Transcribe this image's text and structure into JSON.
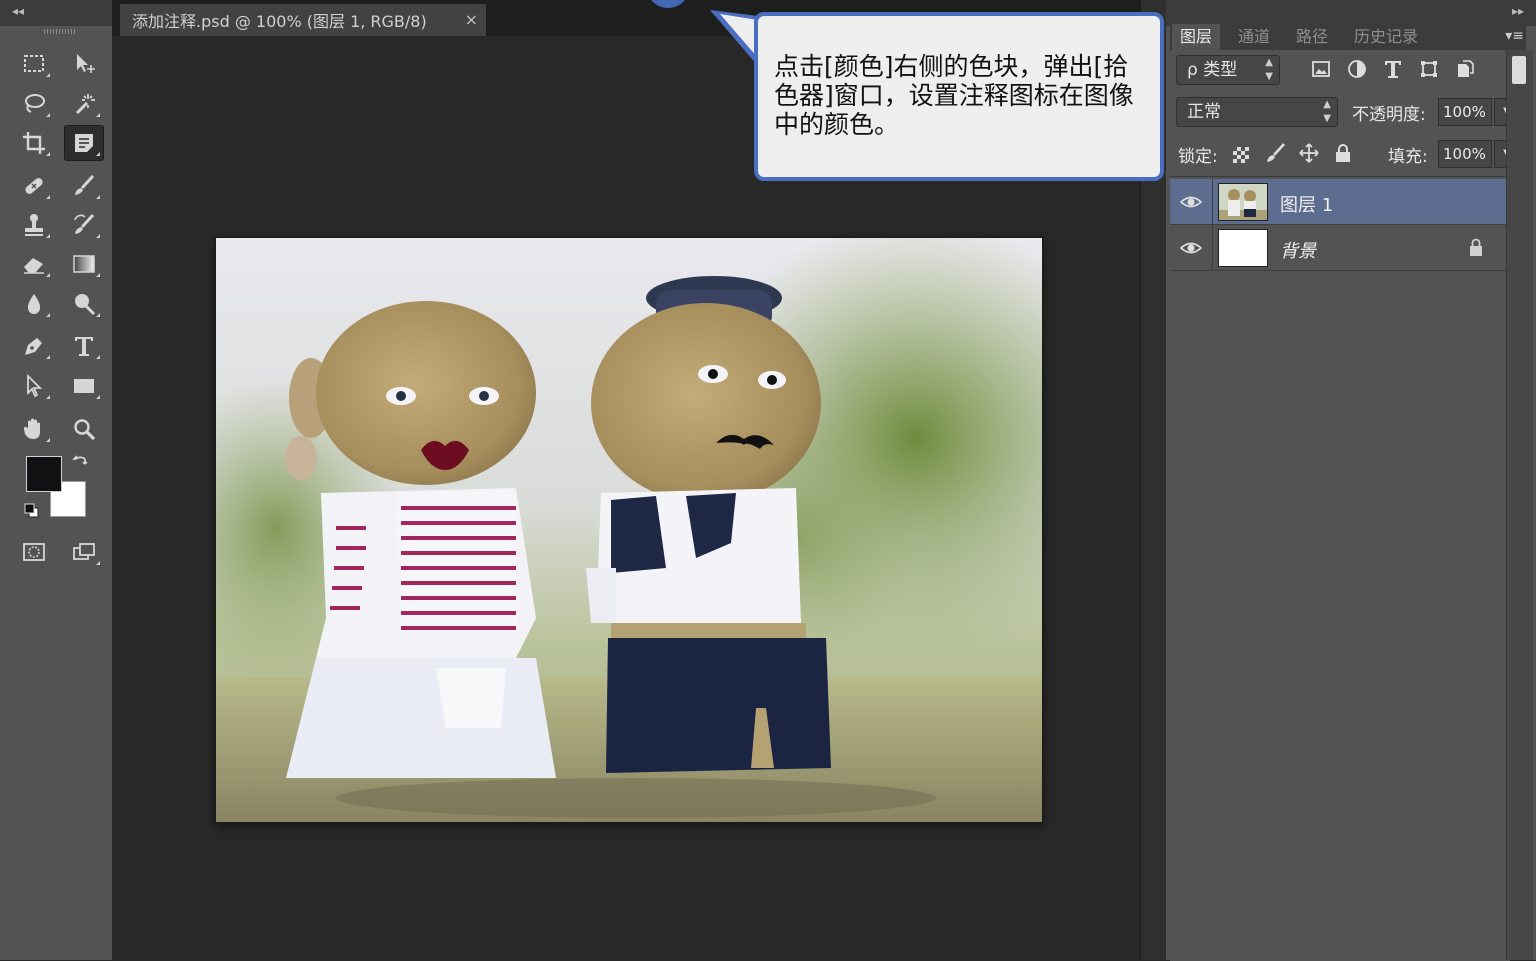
{
  "document": {
    "tab_title": "添加注释.psd @ 100% (图层 1, RGB/8)",
    "close_glyph": "×"
  },
  "callout": {
    "text": "点击[颜色]右侧的色块，弹出[拾色器]窗口，设置注释图标在图像中的颜色。",
    "border_color": "#4a6fc0"
  },
  "toolbar": {
    "collapse_glyph": "◂◂",
    "tools": [
      {
        "name": "rectangular-marquee-icon"
      },
      {
        "name": "move-icon"
      },
      {
        "name": "lasso-icon"
      },
      {
        "name": "magic-wand-icon"
      },
      {
        "name": "crop-icon"
      },
      {
        "name": "note-icon",
        "active": true
      },
      {
        "name": "healing-brush-icon"
      },
      {
        "name": "brush-icon"
      },
      {
        "name": "clone-stamp-icon"
      },
      {
        "name": "history-brush-icon"
      },
      {
        "name": "eraser-icon"
      },
      {
        "name": "gradient-icon"
      },
      {
        "name": "blur-icon"
      },
      {
        "name": "dodge-icon"
      },
      {
        "name": "pen-icon"
      },
      {
        "name": "type-icon"
      },
      {
        "name": "path-selection-icon"
      },
      {
        "name": "rectangle-shape-icon"
      },
      {
        "name": "hand-icon"
      },
      {
        "name": "zoom-icon"
      }
    ],
    "foreground_color": "#111114",
    "background_color": "#ffffff"
  },
  "panel": {
    "collapse_glyph": "▸▸",
    "tabs": [
      "图层",
      "通道",
      "路径",
      "历史记录"
    ],
    "active_tab": "图层",
    "menu_glyph": "▾≡",
    "filter_kind": "ρ 类型",
    "blend_mode": "正常",
    "opacity_label": "不透明度:",
    "opacity_value": "100%",
    "lock_label": "锁定:",
    "fill_label": "填充:",
    "fill_value": "100%",
    "layers": [
      {
        "name": "图层 1",
        "selected": true,
        "visible": true
      },
      {
        "name": "背景",
        "selected": false,
        "visible": true,
        "locked": true
      }
    ]
  },
  "colors": {
    "selection_blue": "#5c6d8f",
    "panel_gray": "#535353",
    "canvas_bg": "#282828"
  }
}
